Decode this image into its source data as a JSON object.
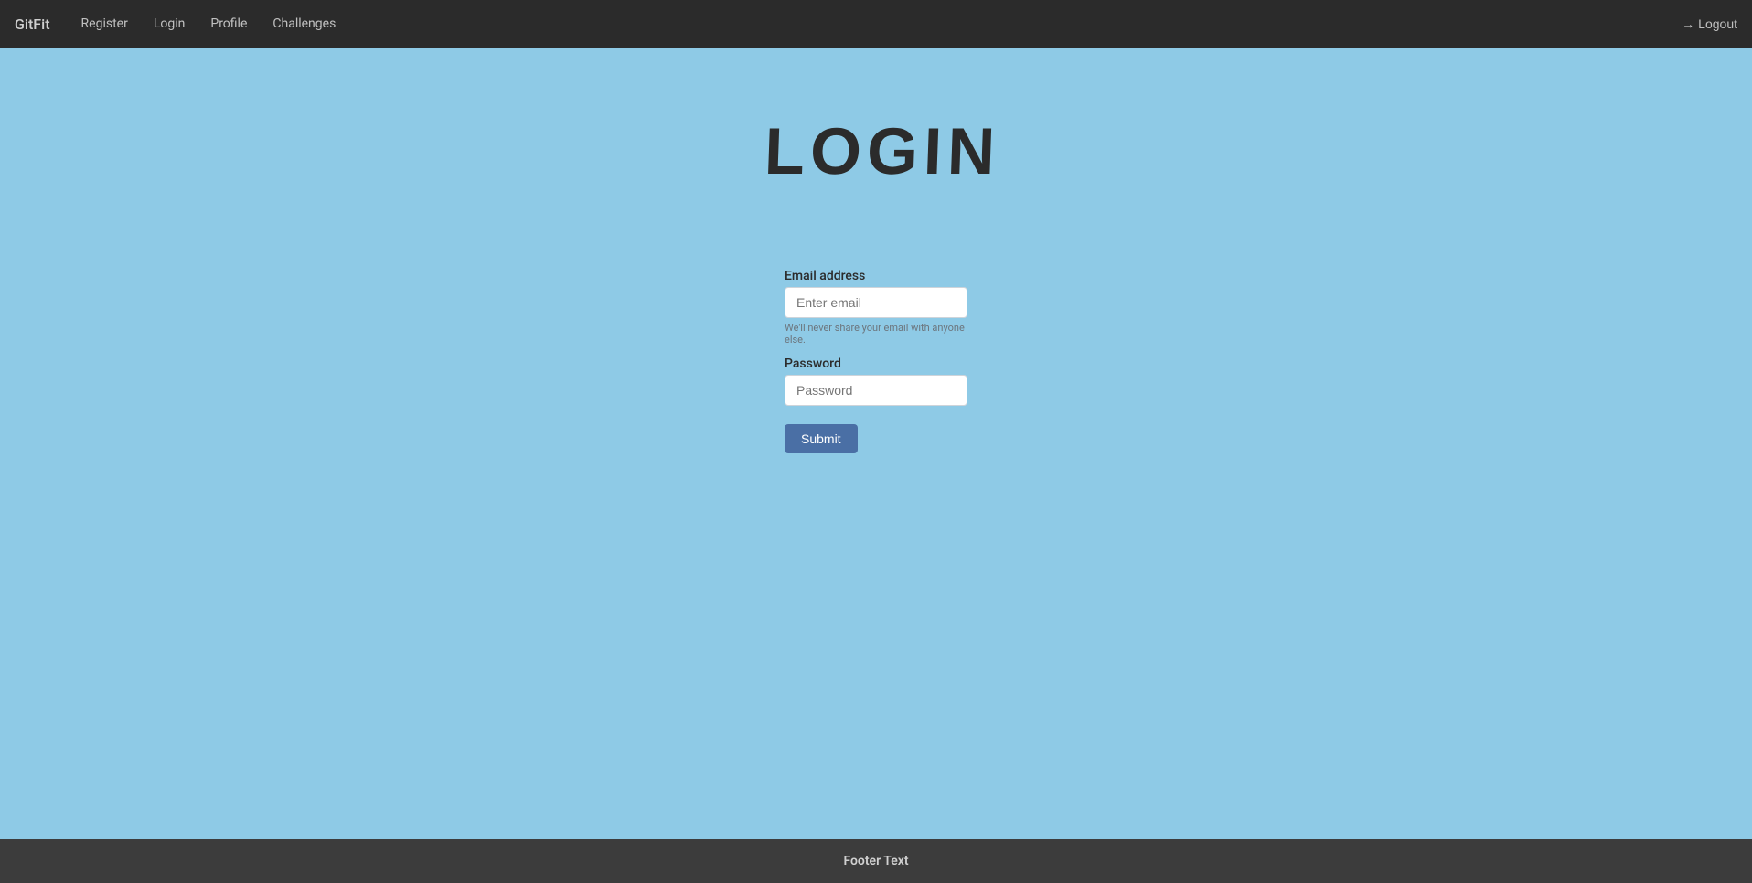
{
  "navbar": {
    "brand": "GitFit",
    "links": [
      {
        "label": "Register",
        "name": "nav-register"
      },
      {
        "label": "Login",
        "name": "nav-login"
      },
      {
        "label": "Profile",
        "name": "nav-profile"
      },
      {
        "label": "Challenges",
        "name": "nav-challenges"
      }
    ],
    "logout_label": "Logout",
    "logout_icon": "→"
  },
  "page": {
    "title": "LOGIN"
  },
  "form": {
    "email_label": "Email address",
    "email_placeholder": "Enter email",
    "email_hint": "We'll never share your email with anyone else.",
    "password_label": "Password",
    "password_placeholder": "Password",
    "submit_label": "Submit"
  },
  "footer": {
    "text": "Footer Text"
  }
}
